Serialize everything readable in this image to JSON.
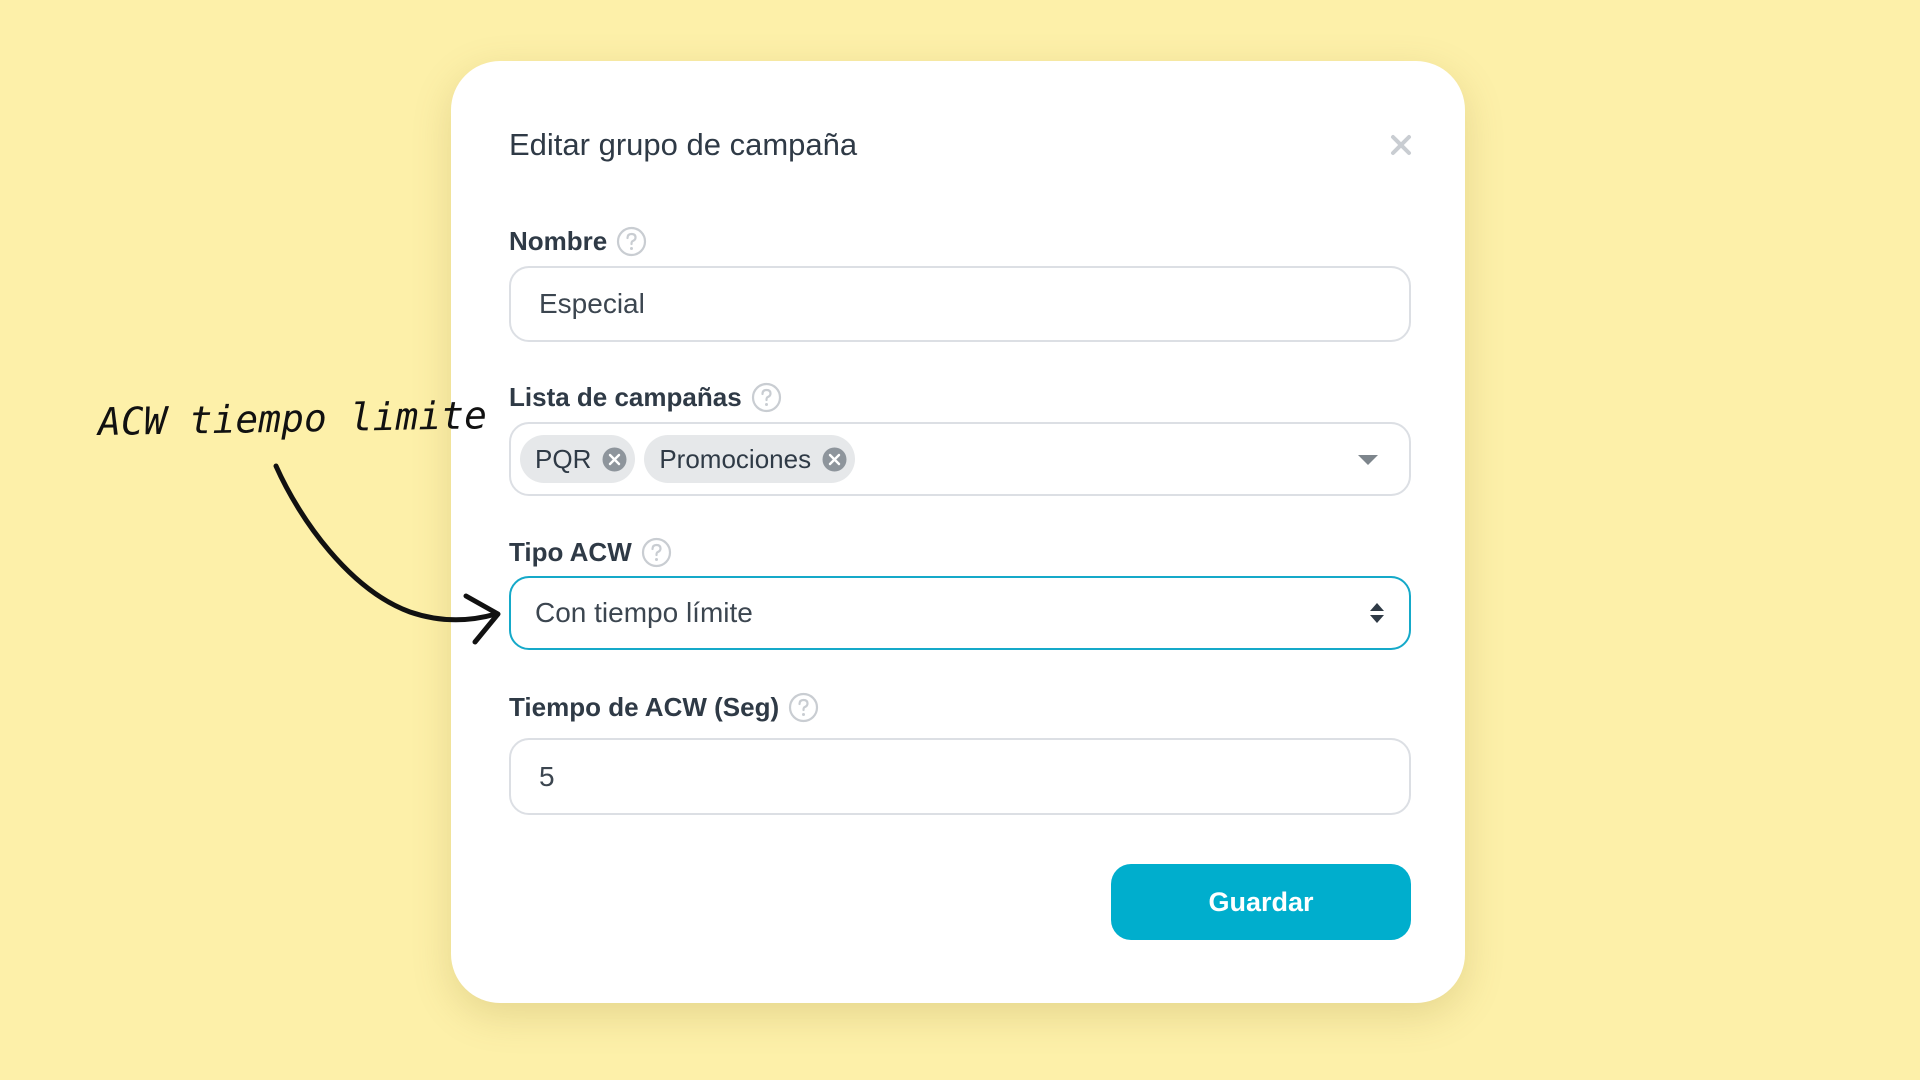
{
  "modal": {
    "title": "Editar grupo de campaña",
    "close_icon": "close-icon"
  },
  "fields": {
    "nombre": {
      "label": "Nombre",
      "value": "Especial",
      "help_icon": "question-circle-icon"
    },
    "lista_campanas": {
      "label": "Lista de campañas",
      "tags": [
        "PQR",
        "Promociones"
      ],
      "help_icon": "question-circle-icon",
      "dropdown_icon": "caret-down-icon"
    },
    "tipo_acw": {
      "label": "Tipo ACW",
      "value": "Con tiempo límite",
      "help_icon": "question-circle-icon",
      "select_icon": "sort-arrows-icon"
    },
    "tiempo_acw": {
      "label": "Tiempo de ACW (Seg)",
      "value": "5",
      "help_icon": "question-circle-icon"
    }
  },
  "actions": {
    "save_label": "Guardar"
  },
  "annotation": {
    "text": "ACW tiempo limite"
  },
  "colors": {
    "background": "#fdf0a9",
    "primary": "#00aecd",
    "focus_border": "#15a9c9",
    "text": "#2f3a46",
    "border": "#dcdfe4",
    "tag_bg": "#e6e8ea"
  }
}
